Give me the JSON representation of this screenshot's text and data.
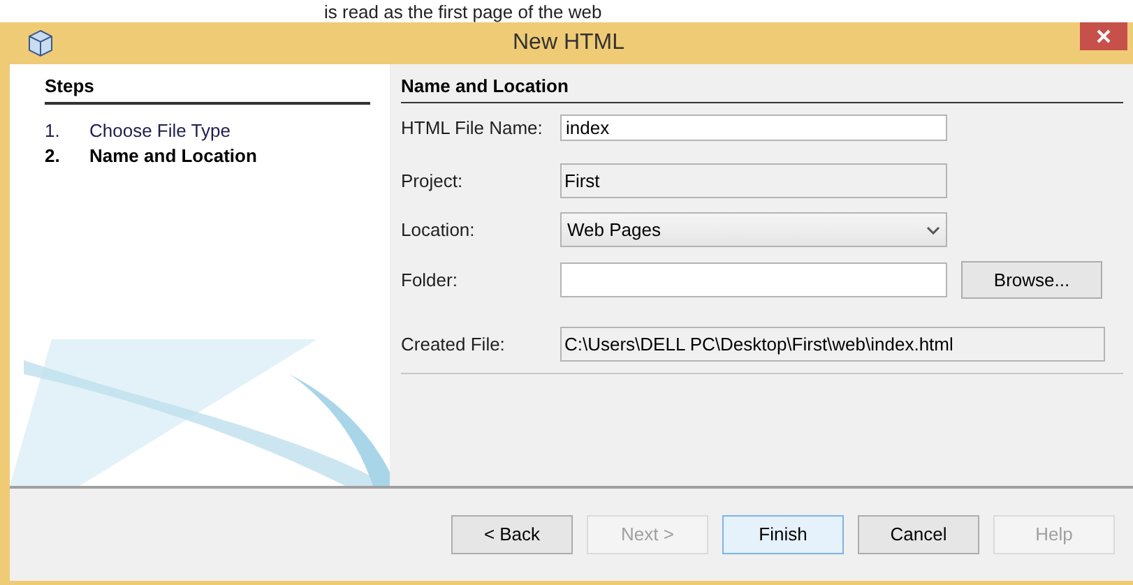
{
  "background_text": "is read as the first page of the web",
  "window": {
    "title": "New HTML"
  },
  "steps": {
    "title": "Steps",
    "items": [
      {
        "number": "1.",
        "label": "Choose File Type",
        "selected": false
      },
      {
        "number": "2.",
        "label": "Name and Location",
        "selected": true
      }
    ]
  },
  "form": {
    "title": "Name and Location",
    "fields": [
      {
        "kind": "input",
        "label": "HTML File Name:",
        "value": "index"
      },
      {
        "kind": "readonly",
        "label": "Project:",
        "value": "First"
      },
      {
        "kind": "select",
        "label": "Location:",
        "value": "Web Pages"
      },
      {
        "kind": "browse",
        "label": "Folder:",
        "button": "Browse..."
      },
      {
        "kind": "readonly-wide",
        "label": "Created File:",
        "value": "C:\\Users\\DELL PC\\Desktop\\First\\web\\index.html"
      }
    ]
  },
  "buttons": [
    {
      "label": "< Back",
      "disabled": false,
      "default": false
    },
    {
      "label": "Next >",
      "disabled": true,
      "default": false
    },
    {
      "label": "Finish",
      "disabled": false,
      "default": true
    },
    {
      "label": "Cancel",
      "disabled": false,
      "default": false
    },
    {
      "label": "Help",
      "disabled": true,
      "default": false
    }
  ]
}
